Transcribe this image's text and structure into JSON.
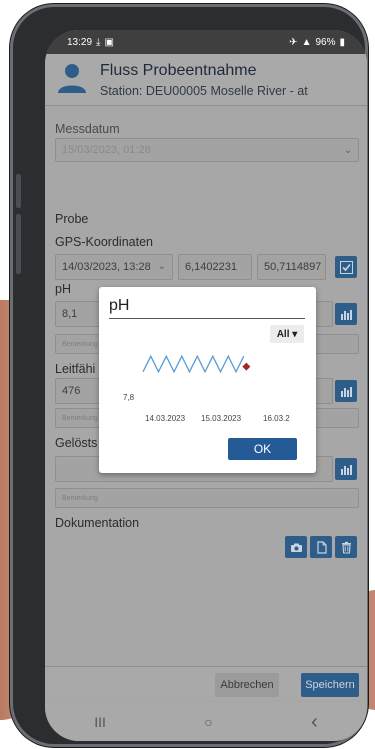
{
  "status_bar": {
    "time": "13:29",
    "battery": "96%"
  },
  "header": {
    "title": "Fluss Probeentnahme",
    "station": "Station: DEU00005 Moselle River - at"
  },
  "form": {
    "messdatum_label": "Messdatum",
    "messdatum_value": "15/03/2023, 01:28",
    "probe_label": "Probe",
    "gps_label": "GPS-Koordinaten",
    "gps_datetime": "14/03/2023, 13:28",
    "gps_lon": "6,1402231",
    "gps_lat": "50,7114897",
    "ph_label": "pH",
    "ph_value": "8,1",
    "note_placeholder": "Bemerkung",
    "leitf_label": "Leitfähi",
    "leitf_value": "476",
    "geloest_label": "Gelösts",
    "doku_label": "Dokumentation"
  },
  "footer": {
    "cancel_label": "Abbrechen",
    "save_label": "Speichern"
  },
  "nav": {
    "recent": "III",
    "home": "○",
    "back": "‹"
  },
  "dialog": {
    "title": "pH",
    "range_label": "All ▾",
    "ok_label": "OK"
  },
  "chart_data": {
    "type": "line",
    "title": "pH",
    "xlabel": "",
    "ylabel": "",
    "x_ticks": [
      "14.03.2023",
      "15.03.2023",
      "16.03.2"
    ],
    "y_ticks": [
      "7,8"
    ],
    "ylim": [
      7.75,
      8.25
    ],
    "series": [
      {
        "x": [
          "14.03.2023 00:00",
          "14.03.2023 03:00",
          "14.03.2023 06:00",
          "14.03.2023 09:00",
          "14.03.2023 12:00",
          "14.03.2023 15:00",
          "14.03.2023 18:00",
          "14.03.2023 21:00",
          "15.03.2023 00:00",
          "15.03.2023 03:00",
          "15.03.2023 06:00",
          "15.03.2023 09:00",
          "15.03.2023 12:00",
          "15.03.2023 15:00"
        ],
        "values": [
          8.05,
          8.2,
          8.05,
          8.2,
          8.05,
          8.2,
          8.05,
          8.2,
          8.05,
          8.2,
          8.05,
          8.2,
          8.05,
          8.2
        ],
        "color": "#5b9bd5"
      }
    ],
    "current_point": {
      "x": "15.03.2023 16:00",
      "value": 8.1,
      "color": "#9b2d2d"
    }
  },
  "colors": {
    "accent": "#2f5d8a",
    "ok_button": "#245b97",
    "line": "#5b9bd5",
    "marker": "#9b2d2d"
  }
}
